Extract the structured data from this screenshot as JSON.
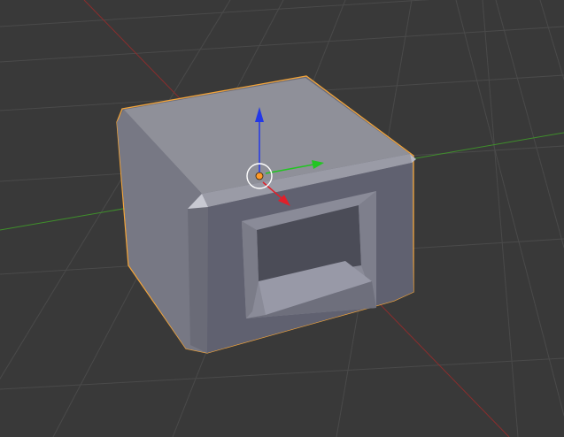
{
  "viewport": {
    "background": "#393939",
    "grid_color": "#4a4a4a",
    "x_axis_color": "#8c2d2d",
    "y_axis_color": "#3f8f2b"
  },
  "object": {
    "selected": true,
    "outline_color": "#f2a43a",
    "shading": {
      "top": "#8e8e98",
      "front_frame": "#5f6070",
      "side": "#787985",
      "inner_back": "#4a4b56",
      "inner_floor": "#9596a3"
    }
  },
  "gizmo": {
    "x_handle_color": "#e0202a",
    "y_handle_color": "#22c522",
    "z_handle_color": "#2338e8",
    "pivot_color": "#ff9a2a",
    "ring_color": "#ffffff"
  },
  "icons": {
    "pivot": "pivot-point-icon",
    "x_arrow": "x-axis-arrow-icon",
    "y_arrow": "y-axis-arrow-icon",
    "z_arrow": "z-axis-arrow-icon"
  }
}
